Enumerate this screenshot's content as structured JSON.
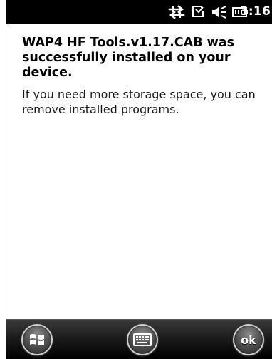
{
  "status_bar": {
    "time": "3:16",
    "icons": [
      "connectivity-icon",
      "message-icon",
      "volume-icon",
      "battery-icon"
    ]
  },
  "content": {
    "headline": "WAP4 HF Tools.v1.17.CAB was successfully installed on your device.",
    "body": "If you need more storage space, you can remove installed programs."
  },
  "taskbar": {
    "start_icon": "windows-logo-icon",
    "keyboard_icon": "keyboard-icon",
    "ok_label": "ok"
  },
  "colors": {
    "status_bar_bg": "#000000",
    "content_bg": "#ffffff",
    "taskbar_bg": "#1c1c1c",
    "text": "#000000"
  }
}
